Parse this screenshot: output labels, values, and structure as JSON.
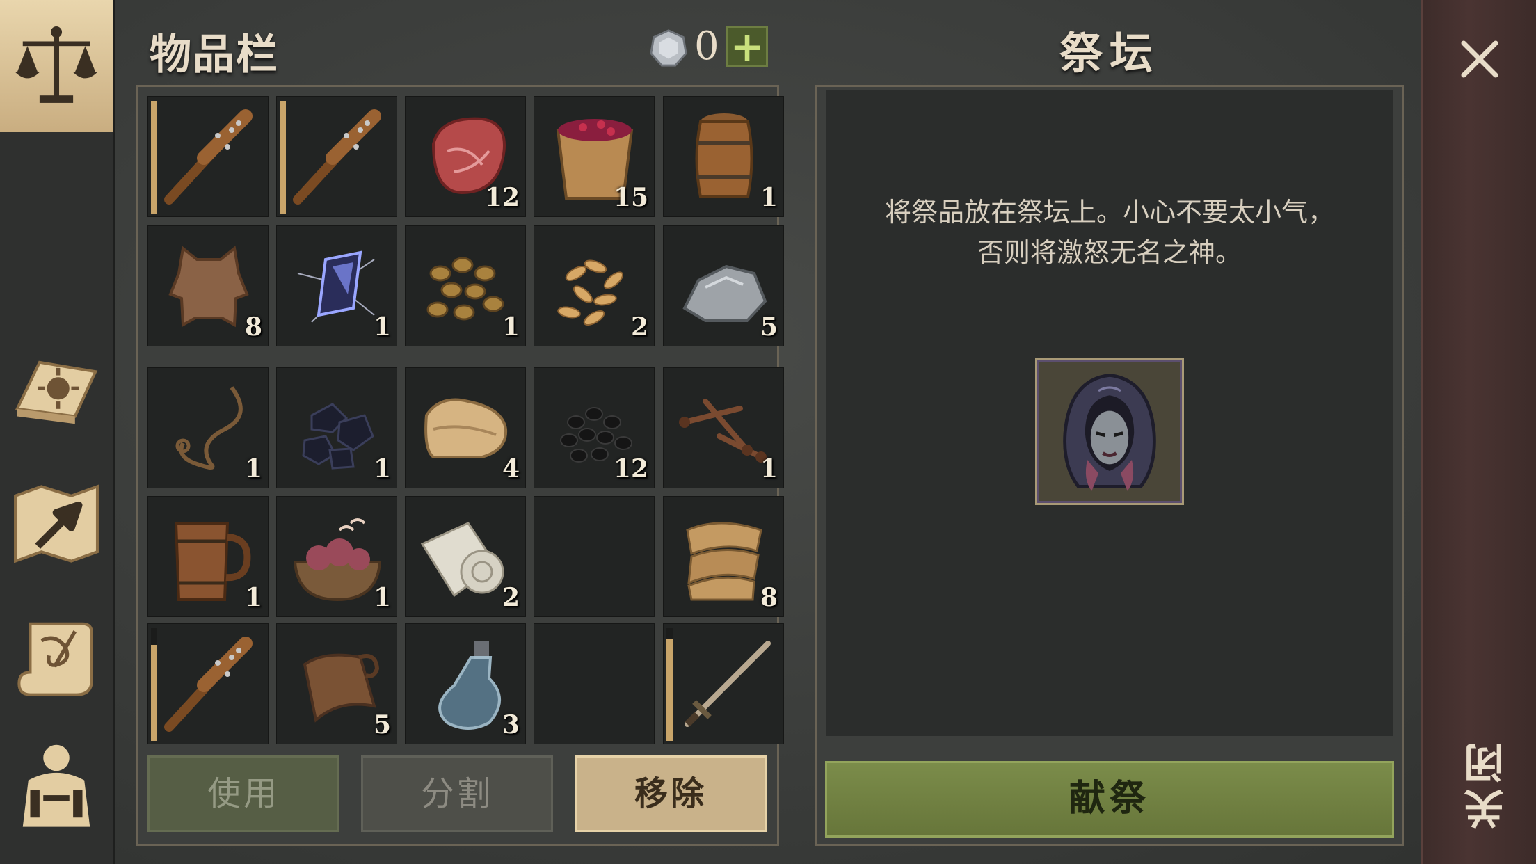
{
  "inventory": {
    "title": "物品栏",
    "currency_count": "0",
    "add_button": "+",
    "slots": [
      {
        "icon": "spiked-club-icon",
        "qty": "",
        "durability": 1.0
      },
      {
        "icon": "spiked-club-icon",
        "qty": "",
        "durability": 1.0
      },
      {
        "icon": "raw-meat-icon",
        "qty": "12"
      },
      {
        "icon": "berry-bucket-icon",
        "qty": "15"
      },
      {
        "icon": "barrel-icon",
        "qty": "1"
      },
      {
        "icon": "animal-hide-icon",
        "qty": "8"
      },
      {
        "icon": "crystal-shard-icon",
        "qty": "1"
      },
      {
        "icon": "beans-icon",
        "qty": "1"
      },
      {
        "icon": "grain-seeds-icon",
        "qty": "2"
      },
      {
        "icon": "stone-ore-icon",
        "qty": "5"
      },
      {
        "icon": "rope-icon",
        "qty": "1"
      },
      {
        "icon": "coal-icon",
        "qty": "1"
      },
      {
        "icon": "leather-roll-icon",
        "qty": "4"
      },
      {
        "icon": "coal-pile-icon",
        "qty": "12"
      },
      {
        "icon": "nails-icon",
        "qty": "1"
      },
      {
        "icon": "wooden-mug-icon",
        "qty": "1"
      },
      {
        "icon": "entrails-bowl-icon",
        "qty": "1"
      },
      {
        "icon": "cloth-roll-icon",
        "qty": "2"
      },
      {
        "icon": "",
        "qty": ""
      },
      {
        "icon": "burlap-cloth-icon",
        "qty": "8"
      },
      {
        "icon": "spiked-club-icon",
        "qty": "",
        "durability": 0.85
      },
      {
        "icon": "leather-scroll-icon",
        "qty": "5"
      },
      {
        "icon": "glass-flask-icon",
        "qty": "3"
      },
      {
        "icon": "",
        "qty": ""
      },
      {
        "icon": "sword-icon",
        "qty": "",
        "durability": 0.9
      }
    ],
    "buttons": {
      "use": "使用",
      "split": "分割",
      "remove": "移除"
    }
  },
  "altar": {
    "title": "祭坛",
    "description_line1": "将祭品放在祭坛上。小心不要太小气，",
    "description_line2": "否则将激怒无名之神。",
    "offering_icon": "hooded-figure-icon",
    "sacrifice_button": "献祭"
  },
  "sidebar": {
    "items": [
      {
        "icon": "scales-icon",
        "active": true
      },
      {
        "icon": "sun-book-icon"
      },
      {
        "icon": "map-arrow-icon"
      },
      {
        "icon": "quest-scroll-icon"
      },
      {
        "icon": "character-icon"
      }
    ]
  },
  "close": {
    "label": "关闭"
  },
  "colors": {
    "accent_green": "#7b8c4a",
    "slot_bg": "#222423",
    "gold": "#c9b28a"
  }
}
